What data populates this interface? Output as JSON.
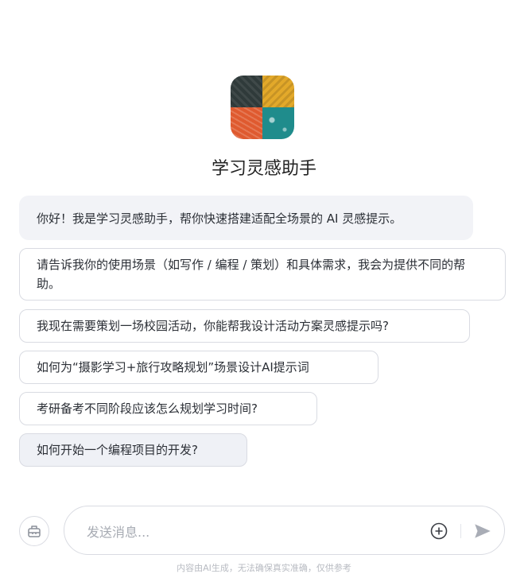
{
  "assistant": {
    "name": "学习灵感助手",
    "greeting": "你好！我是学习灵感助手，帮你快速搭建适配全场景的 AI 灵感提示。"
  },
  "suggestions": [
    "请告诉我你的使用场景（如写作 / 编程 / 策划）和具体需求，我会为提供不同的帮助。",
    "我现在需要策划一场校园活动，你能帮我设计活动方案灵感提示吗?",
    "如何为“摄影学习+旅行攻略规划”场景设计AI提示词",
    "考研备考不同阶段应该怎么规划学习时间?",
    "如何开始一个编程项目的开发?"
  ],
  "composer": {
    "placeholder": "发送消息..."
  },
  "footer": {
    "note": "内容由AI生成，无法确保真实准确，仅供参考"
  }
}
